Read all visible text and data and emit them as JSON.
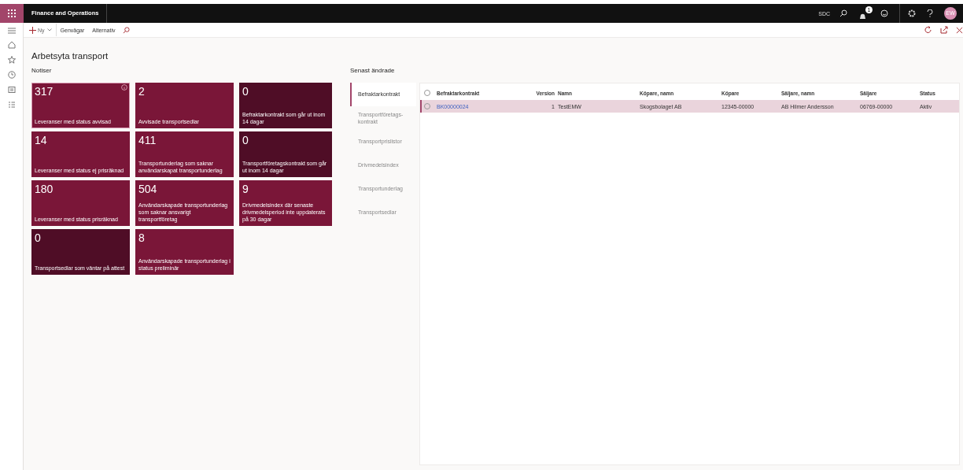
{
  "app": {
    "title": "Finance and Operations",
    "company": "SDC",
    "avatar": "EW",
    "notification_count": "1"
  },
  "commands": [
    {
      "kind": "new",
      "label": "Ny"
    },
    {
      "kind": "text",
      "label": "Genvägar"
    },
    {
      "kind": "text",
      "label": "Alternativ"
    }
  ],
  "page_title": "Arbetsyta transport",
  "tiles_heading": "Notiser",
  "tiles": [
    {
      "count": "317",
      "label": "Leveranser med status avvisad",
      "color": "#7a1638",
      "focused": true
    },
    {
      "count": "2",
      "label": "Avvisade transportsedlar",
      "color": "#7a1638",
      "focused": false
    },
    {
      "count": "0",
      "label": "Befraktarkontrakt som går ut inom 14 dagar",
      "color": "#4f0d26",
      "focused": false
    },
    {
      "count": "14",
      "label": "Leveranser med status ej prisräknad",
      "color": "#7a1638",
      "focused": false
    },
    {
      "count": "411",
      "label": "Transportunderlag som saknar användarskapat transportunderlag",
      "color": "#7a1638",
      "focused": false
    },
    {
      "count": "0",
      "label": "Transportföretagskontrakt som går ut inom 14 dagar",
      "color": "#4f0d26",
      "focused": false
    },
    {
      "count": "180",
      "label": "Leveranser med status prisräknad",
      "color": "#7a1638",
      "focused": false
    },
    {
      "count": "504",
      "label": "Användarskapade transportunderlag som saknar ansvarigt transportföretag",
      "color": "#7a1638",
      "focused": false
    },
    {
      "count": "9",
      "label": "Drivmedelsindex där senaste drivmedelsperiod inte uppdaterats på 30 dagar",
      "color": "#7a1638",
      "focused": false
    },
    {
      "count": "0",
      "label": "Transportsedlar som väntar på attest",
      "color": "#4f0d26",
      "focused": false
    },
    {
      "count": "8",
      "label": "Användarskapade transportunderlag i status preliminär",
      "color": "#7a1638",
      "focused": false
    }
  ],
  "recent_heading": "Senast ändrade",
  "tabs": [
    {
      "label": "Befraktarkontrakt",
      "selected": true
    },
    {
      "label": "Transportföretags-\nkontrakt",
      "selected": false
    },
    {
      "label": "Transportprislistor",
      "selected": false
    },
    {
      "label": "Drivmedelsindex",
      "selected": false
    },
    {
      "label": "Transportunderlag",
      "selected": false
    },
    {
      "label": "Transportsedlar",
      "selected": false
    }
  ],
  "table": {
    "all_selected": false,
    "columns": [
      "Befraktarkontrakt",
      "Version",
      "Namn",
      "Köpare, namn",
      "Köpare",
      "Säljare, namn",
      "Säljare",
      "Status"
    ],
    "rows": [
      {
        "selected": true,
        "cells": [
          "BK00000024",
          "1",
          "TestEMW",
          "Skogsbolaget AB",
          "12345-00000",
          "AB Hilmer Andersson",
          "06769-00000",
          "Aktiv"
        ]
      }
    ]
  }
}
